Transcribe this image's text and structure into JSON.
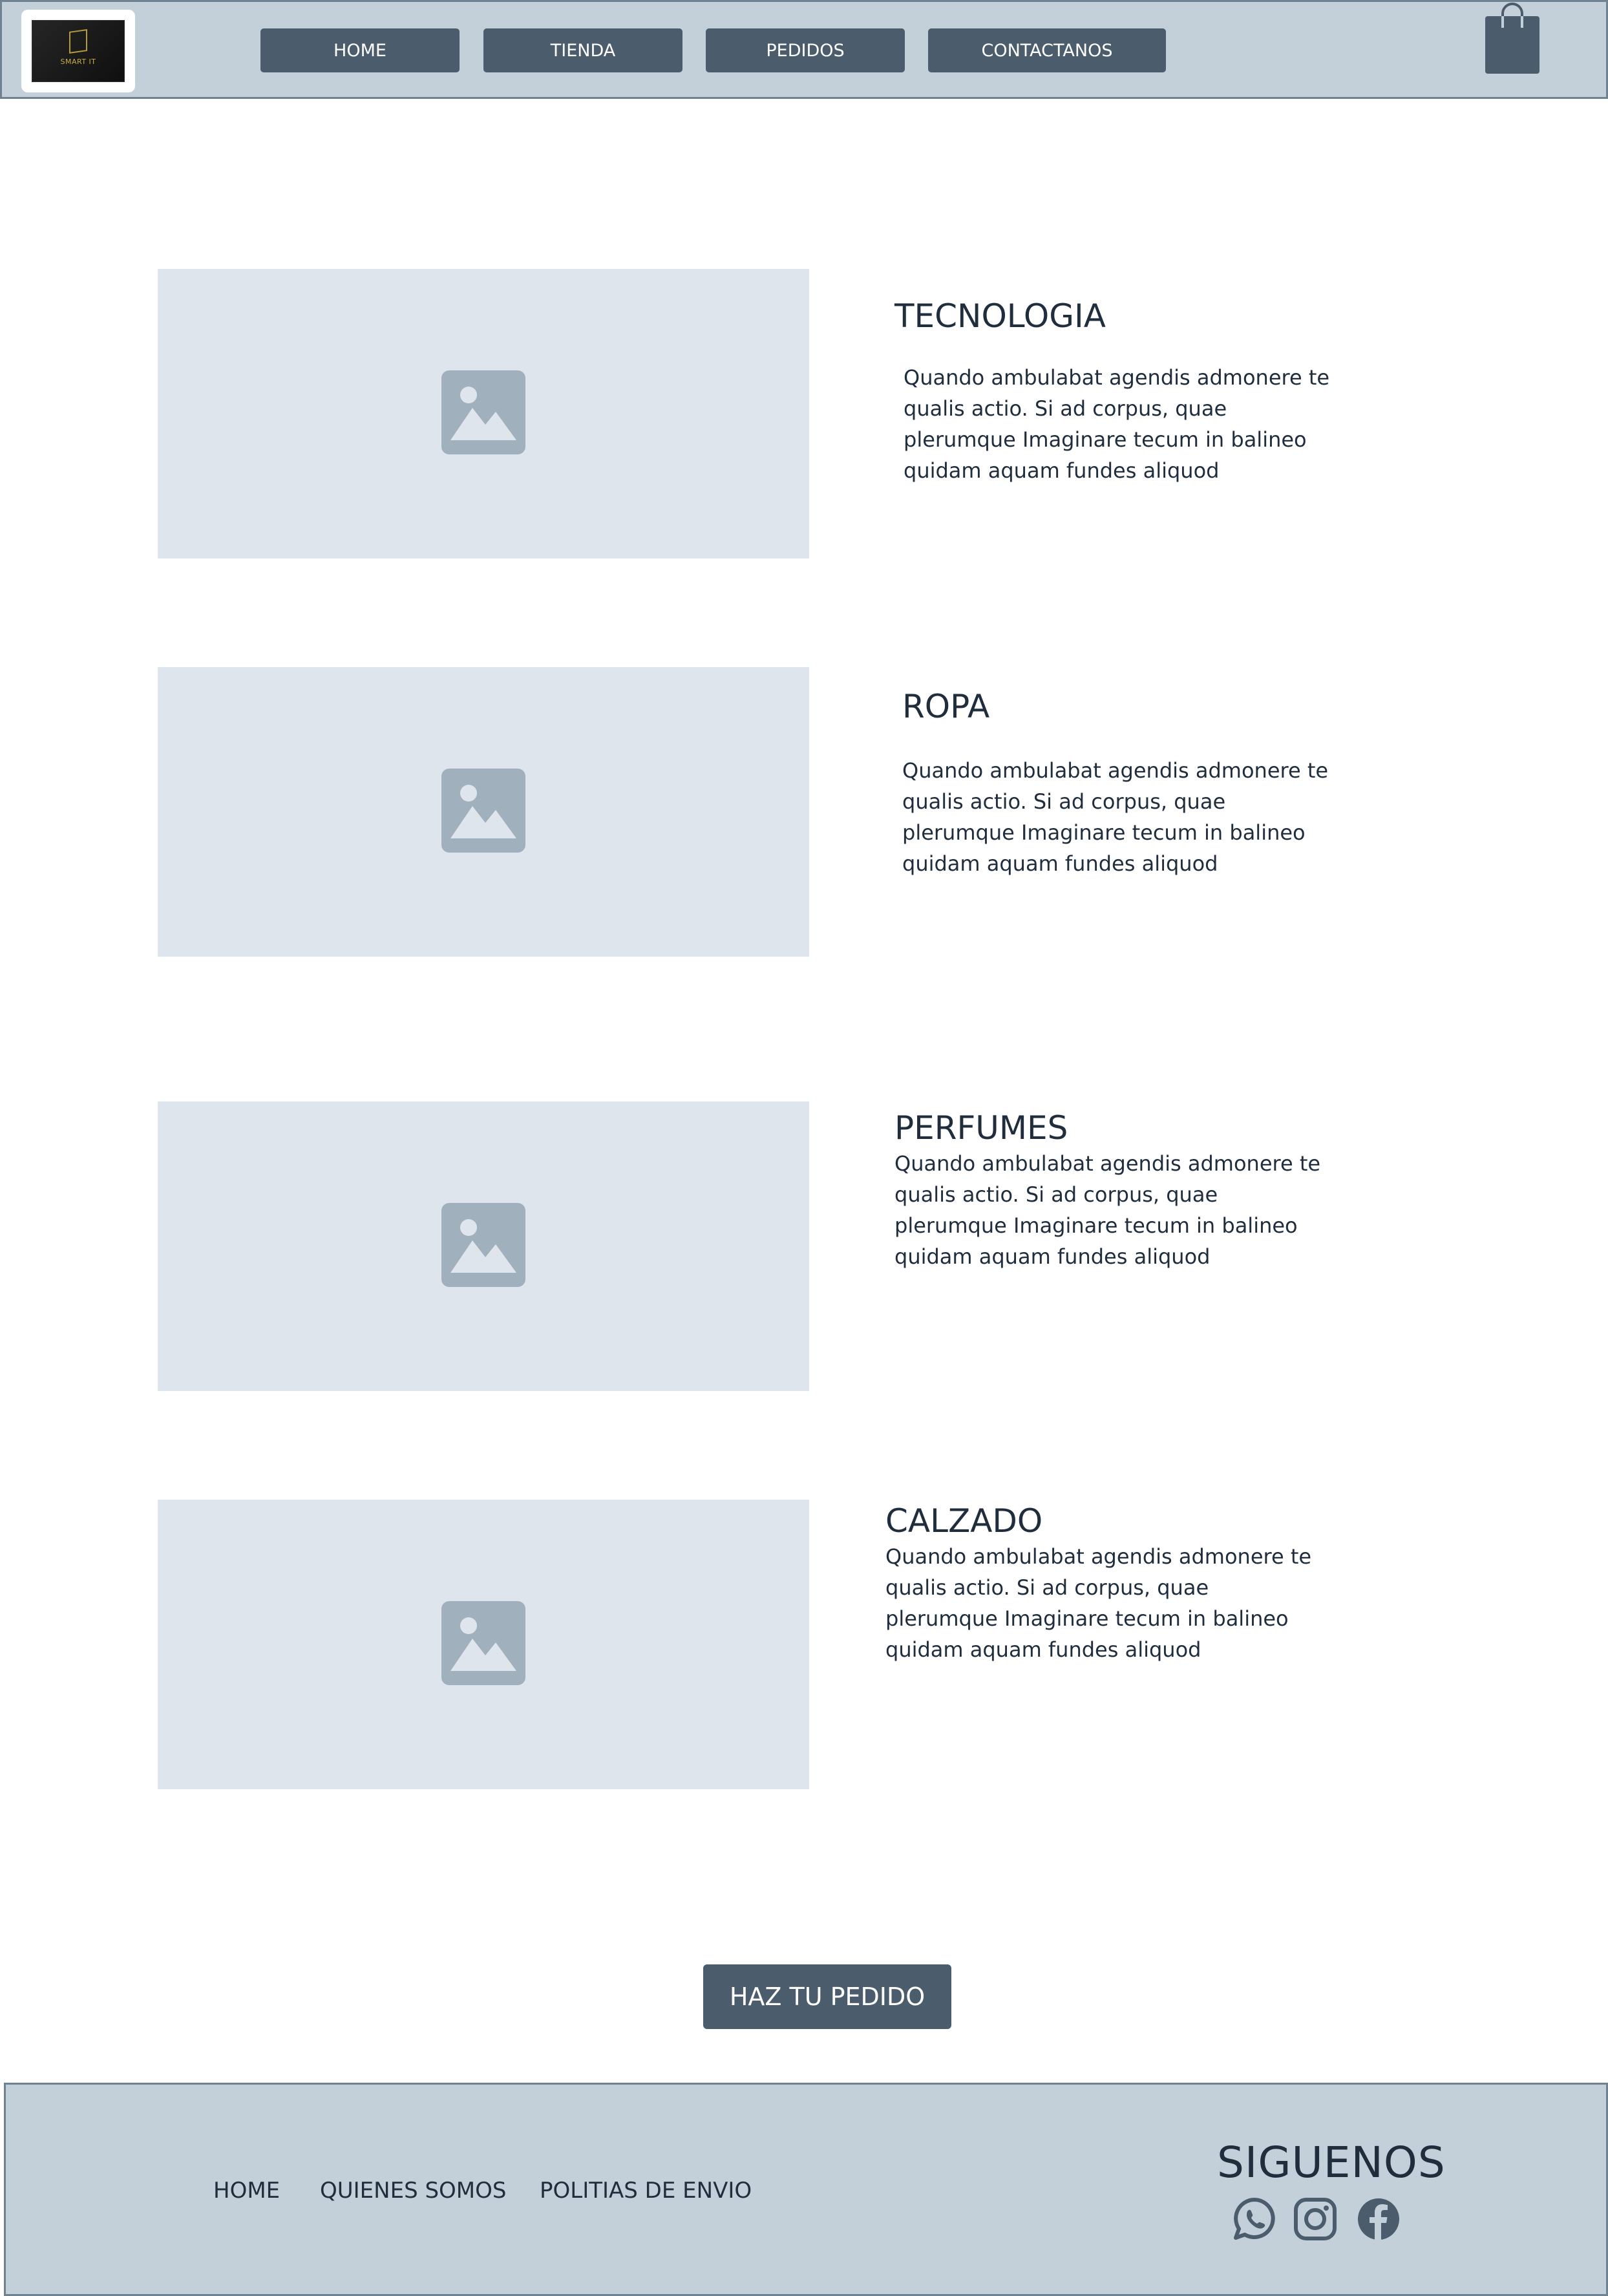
{
  "header": {
    "logo_text": "SMART IT",
    "nav": [
      "HOME",
      "TIENDA",
      "PEDIDOS",
      "CONTACTANOS"
    ]
  },
  "products": [
    {
      "title": "TECNOLOGIA",
      "desc": "Quando ambulabat agendis admonere te qualis actio. Si ad corpus, quae plerumque Imaginare tecum in balineo quidam aquam fundes aliquod"
    },
    {
      "title": "ROPA",
      "desc": "Quando ambulabat agendis admonere te qualis actio. Si ad corpus, quae plerumque Imaginare tecum in balineo quidam aquam fundes aliquod"
    },
    {
      "title": "PERFUMES",
      "desc": "Quando ambulabat agendis admonere te qualis actio. Si ad corpus, quae plerumque Imaginare tecum in balineo quidam aquam fundes aliquod"
    },
    {
      "title": "CALZADO",
      "desc": "Quando ambulabat agendis admonere te qualis actio. Si ad corpus, quae plerumque Imaginare tecum in balineo quidam aquam fundes aliquod"
    }
  ],
  "cta": {
    "label": "HAZ TU PEDIDO"
  },
  "footer": {
    "links": [
      "HOME",
      "QUIENES SOMOS",
      "POLITIAS DE ENVIO"
    ],
    "follow_title": "SIGUENOS",
    "social_icons": [
      "whatsapp-icon",
      "instagram-icon",
      "facebook-icon"
    ]
  },
  "colors": {
    "header_bg": "#c3cfd9",
    "button_bg": "#4b5d6c",
    "placeholder_bg": "#dfe5ed",
    "text": "#1f2d3d"
  }
}
